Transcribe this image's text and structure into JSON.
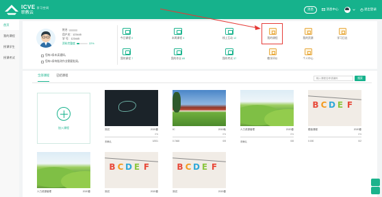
{
  "header": {
    "logo_main": "ICVE",
    "logo_sub": "职教云",
    "logo_tagline": "学习空间",
    "pill_label": "消息",
    "message_center": "消息中心",
    "logout": "退出登录"
  },
  "sidebar": {
    "items": [
      {
        "label": "首页"
      },
      {
        "label": "我的课程"
      },
      {
        "label": "授课学生"
      },
      {
        "label": "授课考试"
      }
    ]
  },
  "profile": {
    "name_label": "姓名:",
    "user_label": "用户名：123445",
    "id_label": "学  号：123445",
    "progress_label": "资料完整度",
    "progress_value": "22%",
    "progress_fraction": 0.22,
    "notice1": "您有2条未读通知。",
    "notice2": "您有1条待批改作业需要批阅。"
  },
  "stats": [
    {
      "label": "今日课程",
      "count": "0"
    },
    {
      "label": "本周课程",
      "count": "4"
    },
    {
      "label": "线上互动",
      "count": "12"
    },
    {
      "label": "我的课程",
      "count": "7"
    },
    {
      "label": "我的作业",
      "count": "89"
    },
    {
      "label": "我的考试",
      "count": "37"
    }
  ],
  "quick_actions": [
    {
      "label": "我的课程"
    },
    {
      "label": "我的资源"
    },
    {
      "label": "学习日志"
    },
    {
      "label": "教学评价"
    },
    {
      "label": "个人中心"
    }
  ],
  "courses": {
    "tabs": [
      {
        "label": "全部课程"
      },
      {
        "label": "已结课程"
      }
    ],
    "search_placeholder": "输入课程名称或编码",
    "search_button": "搜索",
    "add_label": "加入课程",
    "items": [
      {
        "title": "测试",
        "year": "2020春",
        "pct": "0%",
        "teacher": "未确认",
        "students": "0/201"
      },
      {
        "title": "IC",
        "year": "2019秋",
        "pct": "0%",
        "teacher": "0.7468",
        "students": "0/5"
      },
      {
        "title": "人力资源管理",
        "year": "2020春",
        "pct": "0%",
        "teacher": "未确认",
        "students": "0/8"
      },
      {
        "title": "模板课程",
        "year": "2020春",
        "pct": "0%",
        "teacher": "0.000",
        "students": "0/2"
      },
      {
        "title": "人力资源管理",
        "year": "2020春",
        "pct": "",
        "teacher": "",
        "students": ""
      },
      {
        "title": "测试",
        "year": "2020春",
        "pct": "",
        "teacher": "",
        "students": ""
      },
      {
        "title": "测试",
        "year": "2020春",
        "pct": "",
        "teacher": "",
        "students": ""
      }
    ]
  },
  "colors": {
    "brand": "#16b28c",
    "highlight": "#e53935"
  }
}
